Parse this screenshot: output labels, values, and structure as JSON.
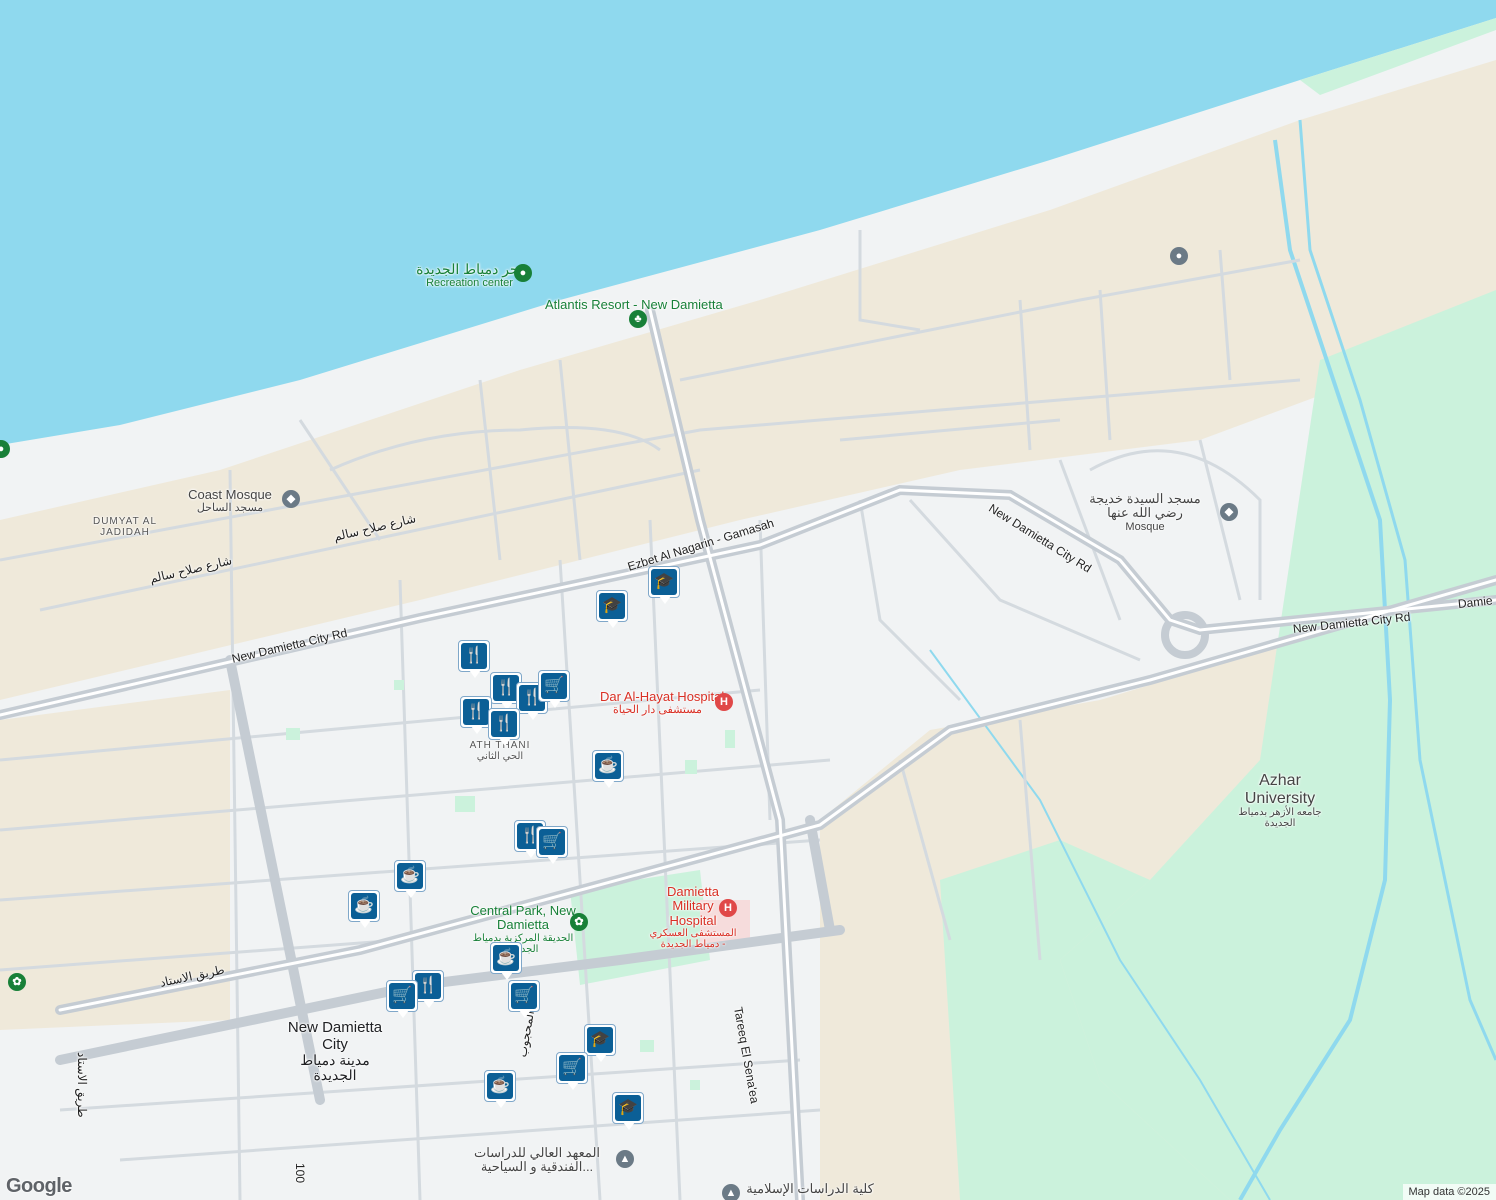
{
  "map": {
    "colors": {
      "water": "#8fd9ee",
      "land": "#f1f3f4",
      "sand": "#efe9da",
      "green": "#cbf2dc",
      "road": "#d4dadf",
      "major_road": "#c5ccd3",
      "poi_blue": "#0b5f96",
      "hospital": "#e04848",
      "park": "#17a05d",
      "worship": "#6b7a86"
    },
    "places": [
      {
        "id": "recreation",
        "name": "بحر دمياط الجديدة",
        "sub": "Recreation center",
        "color": "#188038"
      },
      {
        "id": "atlantis",
        "name": "Atlantis Resort - New Damietta",
        "color": "#188038"
      },
      {
        "id": "coast-mosque",
        "name": "Coast Mosque",
        "sub": "مسجد الساحل",
        "color": "#444"
      },
      {
        "id": "dumyat",
        "name": "DUMYAT AL JADIDAH",
        "color": "#555"
      },
      {
        "id": "sayeda-mosque",
        "name": "مسجد السيدة خديجة رضي الله عنها",
        "sub": "Mosque",
        "color": "#444"
      },
      {
        "id": "dar-alhayat",
        "name": "Dar Al-Hayat Hospital",
        "sub": "مستشفى دار الحياة",
        "color": "#d93025"
      },
      {
        "id": "military",
        "name": "Damietta Military Hospital",
        "sub": "المستشفى العسكري - دمياط الجديدة",
        "color": "#d93025"
      },
      {
        "id": "central-park",
        "name": "Central Park, New Damietta",
        "sub": "الحديقة المركزية بدمياط الجديدة",
        "color": "#188038"
      },
      {
        "id": "azhar",
        "name": "Azhar University",
        "sub": "جامعه الأزهر بدمياط الجديدة",
        "color": "#444"
      },
      {
        "id": "new-damietta",
        "name": "New Damietta City",
        "sub": "مدينة دمياط الجديدة",
        "color": "#202124"
      },
      {
        "id": "athani",
        "name": "ATH THANI",
        "sub": "الحي الثاني",
        "color": "#555"
      },
      {
        "id": "institute",
        "name": "المعهد العالي للدراسات الفندقية و السياحية...",
        "color": "#444"
      },
      {
        "id": "college",
        "name": "كلية الدراسات الإسلامية",
        "color": "#444"
      }
    ],
    "roads": [
      {
        "id": "ezbet",
        "name": "Ezbet Al Nagarin - Gamasah"
      },
      {
        "id": "ndc-rd-1",
        "name": "New Damietta City Rd"
      },
      {
        "id": "ndc-rd-2",
        "name": "New Damietta City Rd"
      },
      {
        "id": "ndc-rd-3",
        "name": "New Damietta City Rd"
      },
      {
        "id": "ndc-rd-4",
        "name": "Damie"
      },
      {
        "id": "salah-1",
        "name": "شارع صلاح سالم"
      },
      {
        "id": "salah-2",
        "name": "شارع صلاح سالم"
      },
      {
        "id": "stadium",
        "name": "طريق الاستاد"
      },
      {
        "id": "stadium-v",
        "name": "طريق الاستاد"
      },
      {
        "id": "senaea",
        "name": "Tareeq El Sena'ea"
      },
      {
        "id": "mahgoub",
        "name": "شارع المحجوب"
      },
      {
        "id": "num-100",
        "name": "100"
      }
    ],
    "pins": [
      {
        "icon": "restaurant",
        "glyph": "🍴"
      },
      {
        "icon": "restaurant",
        "glyph": "🍴"
      },
      {
        "icon": "restaurant",
        "glyph": "🍴"
      },
      {
        "icon": "restaurant",
        "glyph": "🍴"
      },
      {
        "icon": "restaurant",
        "glyph": "🍴"
      },
      {
        "icon": "shopping",
        "glyph": "🛒"
      },
      {
        "icon": "school",
        "glyph": "🎓"
      },
      {
        "icon": "school",
        "glyph": "🎓"
      },
      {
        "icon": "cafe",
        "glyph": "☕"
      },
      {
        "icon": "restaurant",
        "glyph": "🍴"
      },
      {
        "icon": "shopping",
        "glyph": "🛒"
      },
      {
        "icon": "cafe",
        "glyph": "☕"
      },
      {
        "icon": "cafe",
        "glyph": "☕"
      },
      {
        "icon": "cafe",
        "glyph": "☕"
      },
      {
        "icon": "restaurant",
        "glyph": "🍴"
      },
      {
        "icon": "shopping",
        "glyph": "🛒"
      },
      {
        "icon": "shopping",
        "glyph": "🛒"
      },
      {
        "icon": "school",
        "glyph": "🎓"
      },
      {
        "icon": "shopping",
        "glyph": "🛒"
      },
      {
        "icon": "cafe",
        "glyph": "☕"
      },
      {
        "icon": "school",
        "glyph": "🎓"
      }
    ],
    "attribution": "Map data ©2025",
    "logo": "Google"
  }
}
